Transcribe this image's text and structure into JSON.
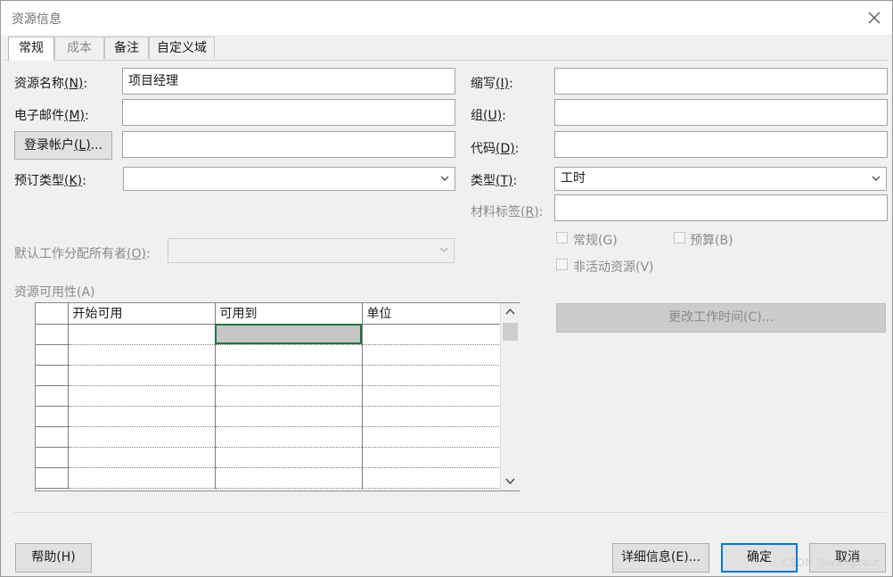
{
  "window": {
    "title": "资源信息"
  },
  "tabs": [
    {
      "label": "常规",
      "active": true
    },
    {
      "label": "成本",
      "disabled": true
    },
    {
      "label": "备注"
    },
    {
      "label": "自定义域"
    }
  ],
  "form": {
    "resource_name": {
      "label": "资源名称",
      "hotkey": "(N)",
      "suffix": ":",
      "value": "项目经理"
    },
    "email": {
      "label": "电子邮件",
      "hotkey": "(M)",
      "suffix": ":",
      "value": ""
    },
    "login_button": {
      "label": "登录帐户",
      "hotkey": "(L)",
      "suffix": "..."
    },
    "login_value": "",
    "booking_type": {
      "label": "预订类型",
      "hotkey": "(K)",
      "suffix": ":",
      "value": ""
    },
    "initials": {
      "label": "缩写",
      "hotkey": "(I)",
      "suffix": ":",
      "value": ""
    },
    "group": {
      "label": "组",
      "hotkey": "(U)",
      "suffix": ":",
      "value": ""
    },
    "code": {
      "label": "代码",
      "hotkey": "(D)",
      "suffix": ":",
      "value": ""
    },
    "type": {
      "label": "类型",
      "hotkey": "(T)",
      "suffix": ":",
      "value": "工时"
    },
    "material_label": {
      "label": "材料标签",
      "hotkey": "(R)",
      "suffix": ":",
      "value": ""
    },
    "default_owner": {
      "label": "默认工作分配所有者",
      "hotkey": "(O)",
      "suffix": ":",
      "value": ""
    },
    "availability_label": "资源可用性(A)",
    "checkboxes": {
      "generic": "常规(G)",
      "budget": "预算(B)",
      "inactive": "非活动资源(V)"
    },
    "change_worktime_button": "更改工作时间(C)..."
  },
  "availability_table": {
    "columns": [
      "开始可用",
      "可用到",
      "单位"
    ],
    "rows": [
      [
        "",
        "",
        ""
      ],
      [
        "",
        "",
        ""
      ],
      [
        "",
        "",
        ""
      ],
      [
        "",
        "",
        ""
      ],
      [
        "",
        "",
        ""
      ],
      [
        "",
        "",
        ""
      ],
      [
        "",
        "",
        ""
      ],
      [
        "",
        "",
        ""
      ]
    ]
  },
  "footer": {
    "help_button": "帮助(H)",
    "details_button": "详细信息(E)...",
    "ok_button": "确定",
    "cancel_button": "取消"
  },
  "watermark": "CSDN @wangxaut",
  "icons": {
    "close": "close-icon",
    "dropdown": "chevron-down-icon",
    "scroll_up": "chevron-up-icon",
    "scroll_down": "chevron-down-icon"
  }
}
